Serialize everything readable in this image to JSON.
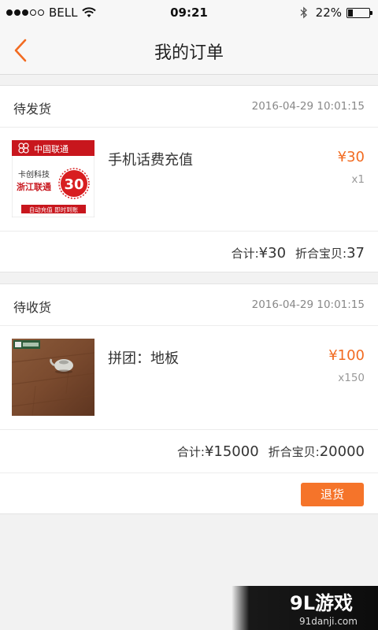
{
  "status_bar": {
    "carrier": "BELL",
    "time": "09:21",
    "battery": "22%"
  },
  "nav": {
    "title": "我的订单"
  },
  "orders": [
    {
      "status": "待发货",
      "time": "2016-04-29 10:01:15",
      "item": {
        "name": "手机话费充值",
        "price": "¥30",
        "qty": "x1",
        "thumb": {
          "brand": "中国联通",
          "line1": "卡创科技",
          "line2": "浙江联通",
          "amount": "30",
          "tagline": "自动充值 即时到账"
        }
      },
      "summary": {
        "total_label": "合计:",
        "total_value": "¥30",
        "count_label": "折合宝贝:",
        "count_value": "37"
      }
    },
    {
      "status": "待收货",
      "time": "2016-04-29 10:01:15",
      "item": {
        "name": "拼团：地板",
        "price": "¥100",
        "qty": "x150"
      },
      "summary": {
        "total_label": "合计:",
        "total_value": "¥15000",
        "count_label": "折合宝贝:",
        "count_value": "20000"
      },
      "action": "退货"
    }
  ],
  "watermark": {
    "logo": "9L游戏",
    "site": "91danji.com"
  }
}
